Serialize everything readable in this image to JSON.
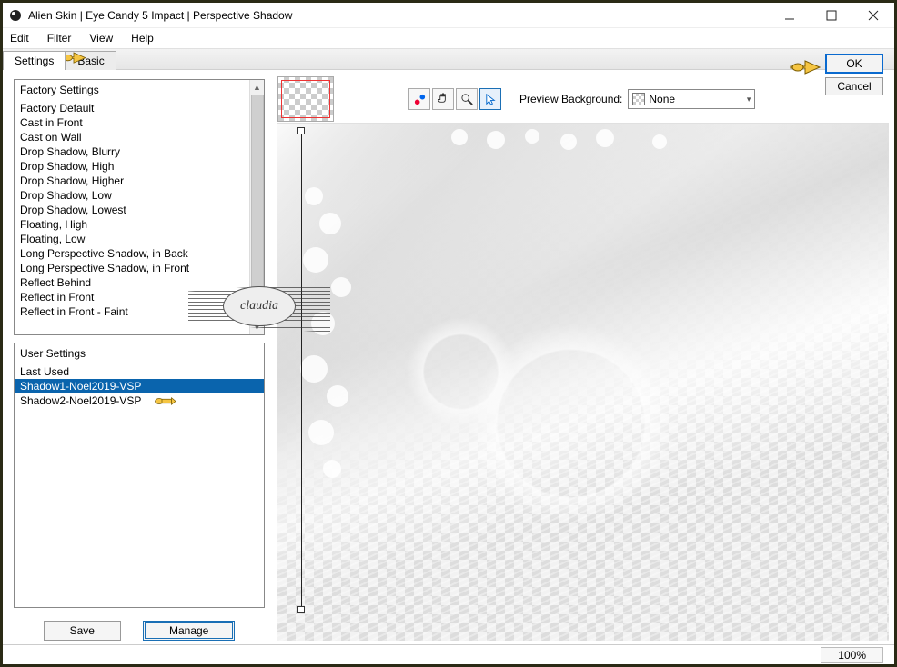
{
  "window": {
    "title": "Alien Skin | Eye Candy 5 Impact | Perspective Shadow"
  },
  "menu": {
    "items": [
      "Edit",
      "Filter",
      "View",
      "Help"
    ]
  },
  "tabs": {
    "settings": "Settings",
    "basic": "Basic"
  },
  "actions": {
    "ok": "OK",
    "cancel": "Cancel"
  },
  "factory": {
    "header": "Factory Settings",
    "items": [
      "Factory Default",
      "Cast in Front",
      "Cast on Wall",
      "Drop Shadow, Blurry",
      "Drop Shadow, High",
      "Drop Shadow, Higher",
      "Drop Shadow, Low",
      "Drop Shadow, Lowest",
      "Floating, High",
      "Floating, Low",
      "Long Perspective Shadow, in Back",
      "Long Perspective Shadow, in Front",
      "Reflect Behind",
      "Reflect in Front",
      "Reflect in Front - Faint"
    ]
  },
  "user": {
    "header": "User Settings",
    "items": [
      "Last Used",
      "Shadow1-Noel2019-VSP",
      "Shadow2-Noel2019-VSP"
    ],
    "selected_index": 1
  },
  "buttons": {
    "save": "Save",
    "manage": "Manage"
  },
  "preview": {
    "bg_label": "Preview Background:",
    "bg_value": "None"
  },
  "status": {
    "zoom": "100%"
  },
  "watermark": {
    "text": "claudia"
  }
}
